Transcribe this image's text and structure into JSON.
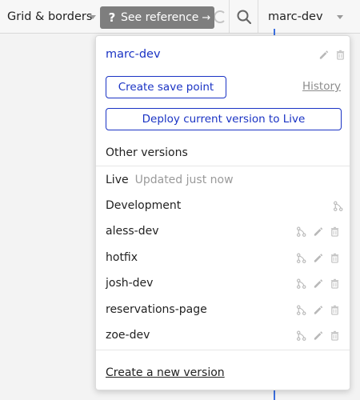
{
  "topbar": {
    "grid_label": "Grid & borders",
    "see_reference_q": "?",
    "see_reference_label": "See reference",
    "see_reference_arrow": "→",
    "current_version": "marc-dev"
  },
  "panel": {
    "current_version_name": "marc-dev",
    "create_save_point_label": "Create save point",
    "history_label": "History",
    "deploy_label": "Deploy current version to Live",
    "other_versions_title": "Other versions",
    "live": {
      "name": "Live",
      "status": "Updated just now"
    },
    "versions": [
      {
        "name": "Development"
      },
      {
        "name": "aless-dev"
      },
      {
        "name": "hotfix"
      },
      {
        "name": "josh-dev"
      },
      {
        "name": "reservations-page"
      },
      {
        "name": "zoe-dev"
      }
    ],
    "create_new_version_label": "Create a new version"
  },
  "icons": {
    "search": "search-icon",
    "edit": "pencil-icon",
    "delete": "trash-icon",
    "merge": "merge-icon"
  },
  "colors": {
    "accent": "#1a33c4",
    "muted_icon": "#b5b5b5",
    "reference_button": "#7e7e7e",
    "canvas_guide": "#3b6fe0"
  }
}
